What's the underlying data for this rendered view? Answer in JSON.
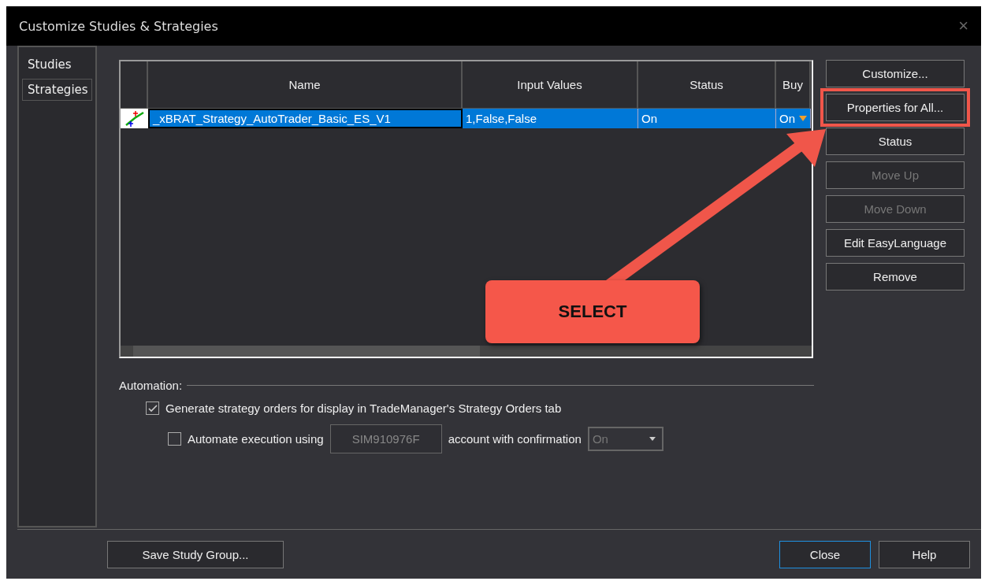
{
  "window": {
    "title": "Customize Studies & Strategies",
    "close": "×"
  },
  "sidebar": {
    "items": [
      {
        "label": "Studies",
        "selected": false
      },
      {
        "label": "Strategies",
        "selected": true
      }
    ]
  },
  "table": {
    "columns": [
      "Name",
      "Input Values",
      "Status",
      "Buy"
    ],
    "rows": [
      {
        "selected": true,
        "cells": [
          "_xBRAT_Strategy_AutoTrader_Basic_ES_V1",
          "1,False,False",
          "On",
          "On"
        ]
      }
    ]
  },
  "buttons": [
    {
      "label": "Customize...",
      "disabled": false,
      "highlighted": false
    },
    {
      "label": "Properties for All...",
      "disabled": false,
      "highlighted": true
    },
    {
      "label": "Status",
      "disabled": false,
      "highlighted": false
    },
    {
      "label": "Move Up",
      "disabled": true,
      "highlighted": false
    },
    {
      "label": "Move Down",
      "disabled": true,
      "highlighted": false
    },
    {
      "label": "Edit EasyLanguage",
      "disabled": false,
      "highlighted": false
    },
    {
      "label": "Remove",
      "disabled": false,
      "highlighted": false
    }
  ],
  "automation": {
    "label": "Automation:",
    "generate": {
      "label": "Generate strategy orders for display in TradeManager's Strategy Orders tab",
      "checked": true
    },
    "automate": {
      "label": "Automate execution using",
      "checked": false,
      "account": "SIM910976F",
      "suffix": "account with confirmation",
      "confirmation": "On"
    }
  },
  "annotation": {
    "callout": "SELECT"
  },
  "footer": {
    "save": "Save Study Group...",
    "close": "Close",
    "help": "Help"
  }
}
